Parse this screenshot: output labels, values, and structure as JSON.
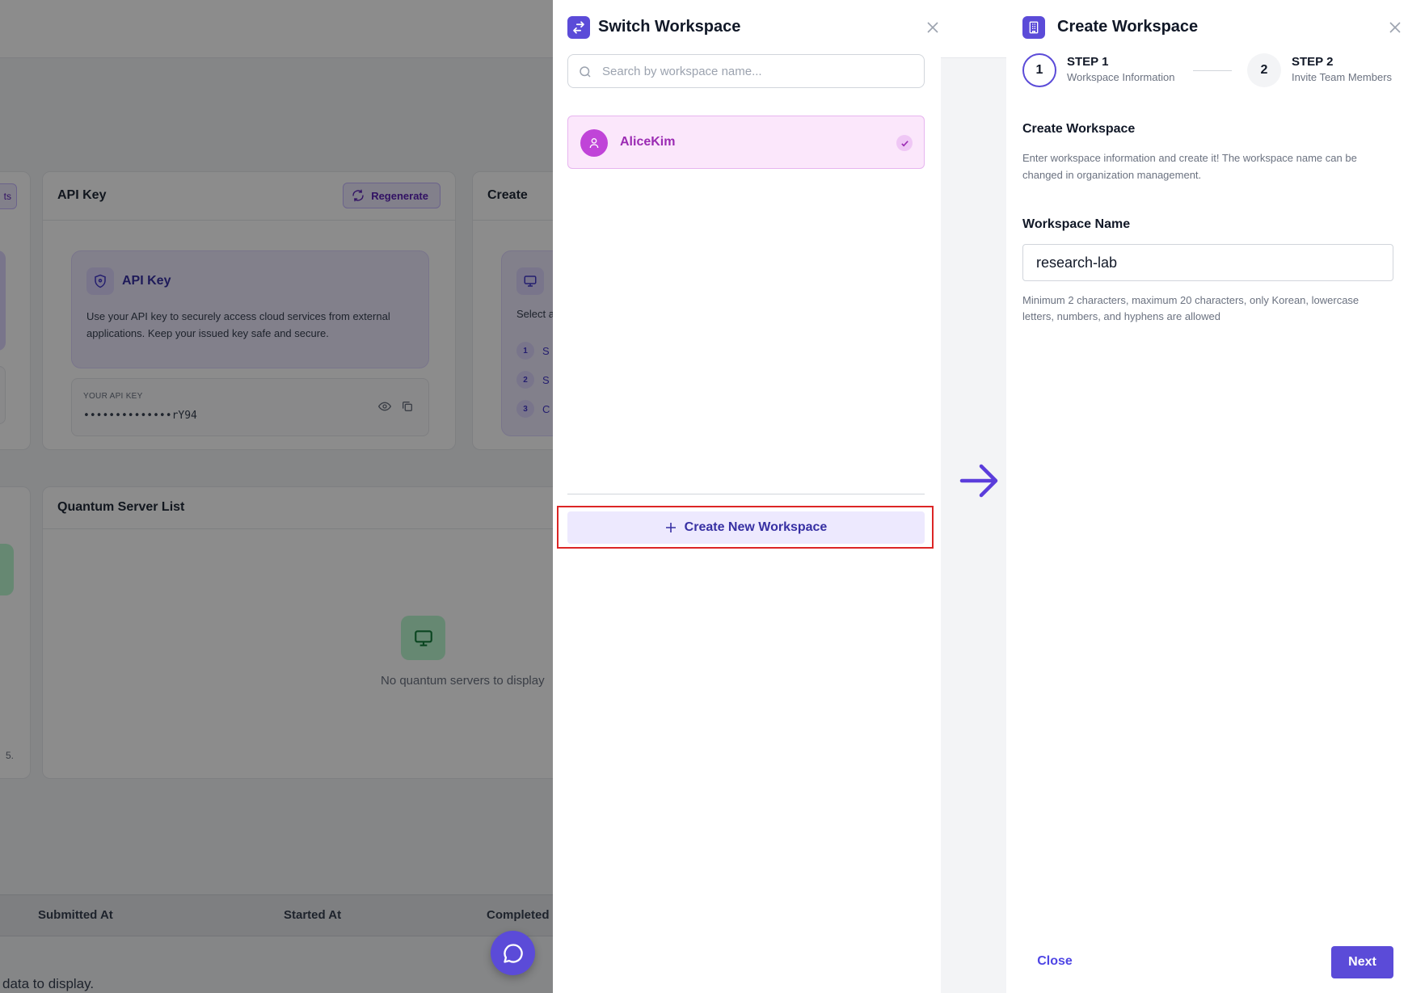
{
  "background": {
    "api_key_card": {
      "partial_button_text": "ts",
      "title": "API Key",
      "regenerate_label": "Regenerate",
      "info_title": "API Key",
      "info_description": "Use your API key to securely access cloud services from external applications. Keep your issued key safe and secure.",
      "key_label": "YOUR API KEY",
      "key_value": "••••••••••••••rY94"
    },
    "create_card": {
      "title": "Create",
      "description_partial": "Select a",
      "steps": [
        {
          "number": "1",
          "text": "S"
        },
        {
          "number": "2",
          "text": "S"
        },
        {
          "number": "3",
          "text": "C"
        }
      ]
    },
    "server_list": {
      "title": "Quantum Server List",
      "empty_text": "No quantum servers to display",
      "side_text": "5."
    },
    "table": {
      "columns": [
        "Submitted At",
        "Started At",
        "Completed"
      ],
      "empty_text": "data to display."
    }
  },
  "switch_workspace": {
    "title": "Switch Workspace",
    "search_placeholder": "Search by workspace name...",
    "workspaces": [
      {
        "name": "AliceKim",
        "selected": true
      }
    ],
    "create_new_label": "Create New Workspace"
  },
  "create_workspace": {
    "title": "Create Workspace",
    "steps": [
      {
        "number": "1",
        "label": "STEP 1",
        "sub": "Workspace Information",
        "active": true
      },
      {
        "number": "2",
        "label": "STEP 2",
        "sub": "Invite Team Members",
        "active": false
      }
    ],
    "section_title": "Create Workspace",
    "section_description": "Enter workspace information and create it! The workspace name can be changed in organization management.",
    "field_label": "Workspace Name",
    "field_value": "research-lab",
    "field_hint": "Minimum 2 characters, maximum 20 characters, only Korean, lowercase letters, numbers, and hyphens are allowed",
    "close_label": "Close",
    "next_label": "Next"
  },
  "colors": {
    "accent": "#5b4bd8",
    "selected_bg": "#fbe7fb",
    "highlight_border": "#dc2626"
  }
}
